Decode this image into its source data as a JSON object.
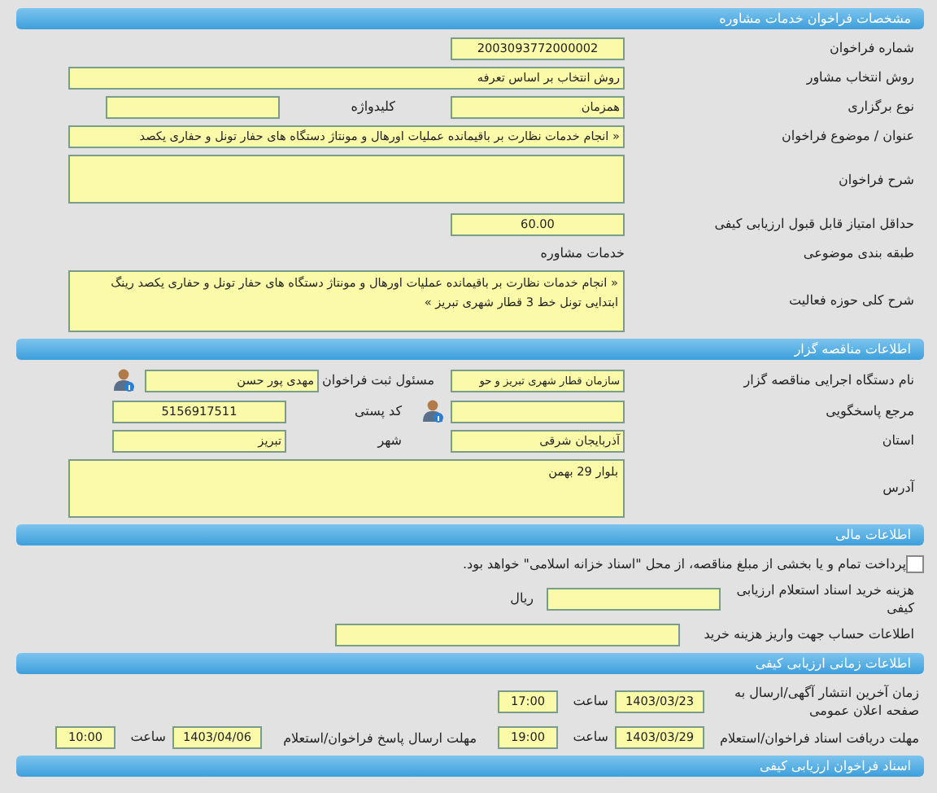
{
  "call_details": {
    "title": "مشخصات فراخوان خدمات مشاوره",
    "call_number": {
      "label": "شماره فراخوان",
      "value": "2003093772000002"
    },
    "selection_method": {
      "label": "روش انتخاب مشاور",
      "value": "روش انتخاب بر اساس تعرفه"
    },
    "holding_type": {
      "label": "نوع برگزاری",
      "value": "همزمان"
    },
    "keyword": {
      "label": "کلیدواژه"
    },
    "subject": {
      "label": "عنوان / موضوع فراخوان",
      "value": "« انجام خدمات نظارت بر باقیمانده عملیات اورهال و مونتاژ دستگاه های حفار تونل و حفاری یکصد"
    },
    "description": {
      "label": "شرح فراخوان"
    },
    "min_score": {
      "label": "حداقل امتیاز قابل قبول ارزیابی کیفی",
      "value": "60.00"
    },
    "category": {
      "label": "طبقه بندی موضوعی",
      "value": "خدمات مشاوره"
    },
    "scope": {
      "label": "شرح کلی حوزه فعالیت",
      "value": "« انجام خدمات نظارت بر باقیمانده عملیات اورهال و مونتاژ دستگاه های حفار تونل و حفاری یکصد رینگ ابتدایی تونل خط 3 قطار شهری تبریز »"
    }
  },
  "organizer": {
    "title": "اطلاعات مناقصه گزار",
    "org_name": {
      "label": "نام دستگاه اجرایی مناقصه گزار",
      "value": "سازمان قطار شهری تبریز و حو"
    },
    "registrar": {
      "label": "مسئول ثبت فراخوان",
      "value": "مهدی پور حسن"
    },
    "reference": {
      "label": "مرجع پاسخگویی"
    },
    "postal_code": {
      "label": "کد پستی",
      "value": "5156917511"
    },
    "province": {
      "label": "استان",
      "value": "آذربایجان شرقی"
    },
    "city": {
      "label": "شهر",
      "value": "تبریز"
    },
    "address": {
      "label": "آدرس",
      "value": "بلوار 29 بهمن"
    }
  },
  "financial": {
    "title": "اطلاعات مالی",
    "treasury": {
      "checked": false,
      "label": "پرداخت تمام و یا بخشی از مبلغ مناقصه، از محل \"اسناد خزانه اسلامی\" خواهد بود."
    },
    "cost": {
      "label": "هزینه خرید اسناد استعلام ارزیابی کیفی",
      "unit": "ریال"
    },
    "account": {
      "label": "اطلاعات حساب جهت واریز هزینه خرید"
    }
  },
  "schedule": {
    "title": "اطلاعات زمانی ارزیابی کیفی",
    "publish": {
      "label": "زمان آخرین انتشار آگهی/ارسال به صفحه اعلان عمومی",
      "date": "1403/03/23",
      "time_label": "ساعت",
      "time": "17:00"
    },
    "receive_deadline": {
      "label": "مهلت دریافت اسناد فراخوان/استعلام",
      "date": "1403/03/29",
      "time_label": "ساعت",
      "time": "19:00"
    },
    "submit_deadline": {
      "label": "مهلت ارسال پاسخ فراخوان/استعلام",
      "date": "1403/04/06",
      "time_label": "ساعت",
      "time": "10:00"
    }
  },
  "documents": {
    "title": "اسناد فراخوان ارزیابی کیفی"
  }
}
